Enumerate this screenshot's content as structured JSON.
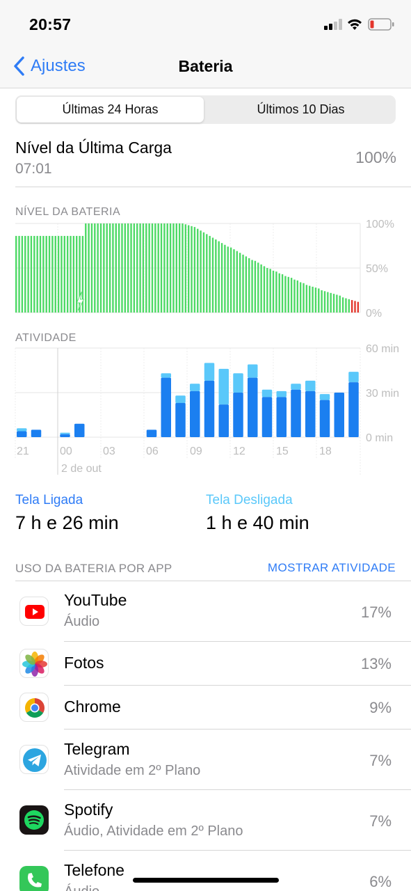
{
  "status_bar": {
    "time": "20:57"
  },
  "nav": {
    "back_label": "Ajustes",
    "title": "Bateria"
  },
  "segments": {
    "left": "Últimas 24 Horas",
    "right": "Últimos 10 Dias",
    "selected": "left"
  },
  "last_charge": {
    "title": "Nível da Última Carga",
    "time": "07:01",
    "percent": "100%"
  },
  "battery_chart": {
    "label": "NÍVEL DA BATERIA",
    "y_ticks": [
      "100%",
      "50%",
      "0%"
    ],
    "levels": [
      86,
      86,
      86,
      86,
      86,
      86,
      86,
      86,
      86,
      86,
      86,
      86,
      86,
      86,
      86,
      86,
      86,
      86,
      86,
      86,
      86,
      86,
      86,
      100,
      100,
      100,
      100,
      100,
      100,
      100,
      100,
      100,
      100,
      100,
      100,
      100,
      100,
      100,
      100,
      100,
      100,
      100,
      100,
      100,
      100,
      100,
      100,
      100,
      100,
      100,
      100,
      100,
      100,
      100,
      100,
      100,
      99,
      98,
      97,
      96,
      94,
      92,
      90,
      88,
      86,
      84,
      82,
      80,
      78,
      76,
      74,
      73,
      71,
      69,
      67,
      65,
      63,
      61,
      59,
      58,
      56,
      54,
      52,
      50,
      49,
      47,
      46,
      44,
      43,
      41,
      40,
      39,
      37,
      36,
      34,
      33,
      31,
      30,
      29,
      28,
      27,
      25,
      24,
      23,
      22,
      21,
      20,
      19,
      17,
      16,
      15,
      14,
      13,
      12
    ],
    "charge_start_index": 21,
    "low_color": "#e3352b",
    "green": "#4cd964"
  },
  "activity_chart": {
    "label": "ATIVIDADE",
    "y_ticks": [
      "60 min",
      "30 min",
      "0 min"
    ],
    "x_ticks": [
      "21",
      "00",
      "03",
      "06",
      "09",
      "12",
      "15",
      "18"
    ],
    "date_label": "2 de out",
    "screen_on": [
      4,
      5,
      0,
      2,
      9,
      0,
      0,
      0,
      0,
      5,
      40,
      23,
      31,
      38,
      22,
      30,
      40,
      27,
      27,
      32,
      31,
      25,
      30,
      37
    ],
    "screen_off": [
      2,
      0,
      0,
      1,
      0,
      0,
      0,
      0,
      0,
      0,
      3,
      5,
      5,
      12,
      24,
      13,
      9,
      5,
      4,
      4,
      7,
      4,
      0,
      7
    ],
    "on_color": "#1b7ff0",
    "off_color": "#5ac8fa"
  },
  "stats": {
    "screen_on_label": "Tela Ligada",
    "screen_on_value": "7 h e 26 min",
    "screen_off_label": "Tela Desligada",
    "screen_off_value": "1 h e 40 min"
  },
  "usage": {
    "header": "USO DA BATERIA POR APP",
    "action": "MOSTRAR ATIVIDADE",
    "apps": [
      {
        "name": "YouTube",
        "sub": "Áudio",
        "percent": "17%",
        "icon": "youtube-icon"
      },
      {
        "name": "Fotos",
        "sub": "",
        "percent": "13%",
        "icon": "photos-icon"
      },
      {
        "name": "Chrome",
        "sub": "",
        "percent": "9%",
        "icon": "chrome-icon"
      },
      {
        "name": "Telegram",
        "sub": "Atividade em 2º Plano",
        "percent": "7%",
        "icon": "telegram-icon"
      },
      {
        "name": "Spotify",
        "sub": "Áudio, Atividade em 2º Plano",
        "percent": "7%",
        "icon": "spotify-icon"
      },
      {
        "name": "Telefone",
        "sub": "Áudio",
        "percent": "6%",
        "icon": "phone-icon"
      }
    ]
  }
}
